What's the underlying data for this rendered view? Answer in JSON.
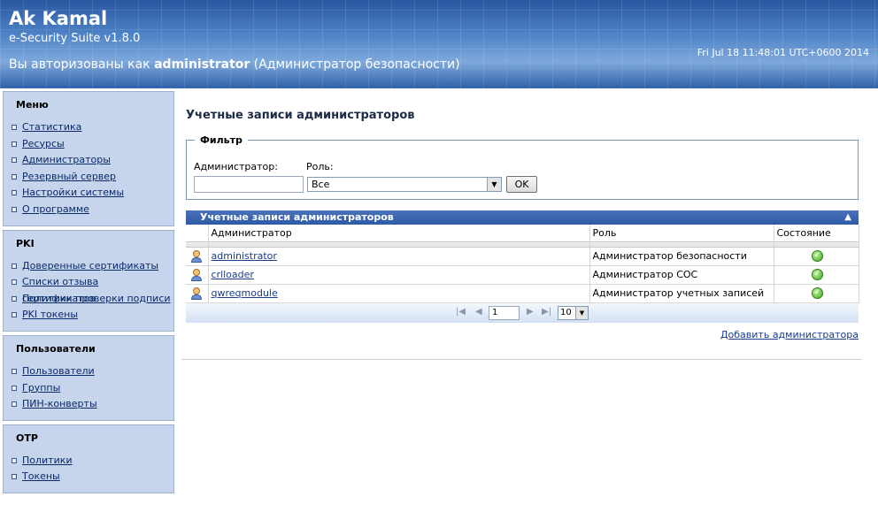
{
  "header": {
    "app_name": "Ak Kamal",
    "version": "e-Security Suite v1.8.0",
    "auth_prefix": "Вы авторизованы как ",
    "auth_user": "administrator",
    "auth_role": " (Администратор безопасности)",
    "datetime": "Fri Jul 18 11:48:01 UTC+0600 2014"
  },
  "sidebar": {
    "menu": {
      "title": "Меню",
      "items": [
        "Статистика",
        "Ресурсы",
        "Администраторы",
        "Резервный сервер",
        "Настройки системы",
        "О программе"
      ]
    },
    "pki": {
      "title": "PKI",
      "items": [
        "Доверенные сертификаты",
        "Списки отзыва сертификатов",
        "Политики проверки подписи",
        "PKI токены"
      ]
    },
    "users": {
      "title": "Пользователи",
      "items": [
        "Пользователи",
        "Группы",
        "ПИН-конверты"
      ]
    },
    "otp": {
      "title": "OTP",
      "items": [
        "Политики",
        "Токены"
      ]
    }
  },
  "main": {
    "page_title": "Учетные записи администраторов",
    "filter": {
      "legend": "Фильтр",
      "admin_label": "Администратор:",
      "admin_value": "",
      "role_label": "Роль:",
      "role_selected": "Все",
      "ok_label": "OK"
    },
    "grid": {
      "title": "Учетные записи администраторов",
      "columns": [
        "Администратор",
        "Роль",
        "Состояние"
      ],
      "rows": [
        {
          "admin": "administrator",
          "role": "Администратор безопасности",
          "status_icon": "ok-icon"
        },
        {
          "admin": "crlloader",
          "role": "Администратор СОС",
          "status_icon": "ok-icon"
        },
        {
          "admin": "qwreqmodule",
          "role": "Администратор учетных записей",
          "status_icon": "ok-icon"
        }
      ],
      "pager": {
        "page": "1",
        "page_size": "10"
      }
    },
    "add_link": "Добавить администратора"
  },
  "colors": {
    "header_blue": "#3e6fb5",
    "sidebar_bg": "#c6d4ec",
    "grid_title_bg": "#2e5aa6",
    "link": "#1a3c8c",
    "status_ok": "#3faa22"
  }
}
